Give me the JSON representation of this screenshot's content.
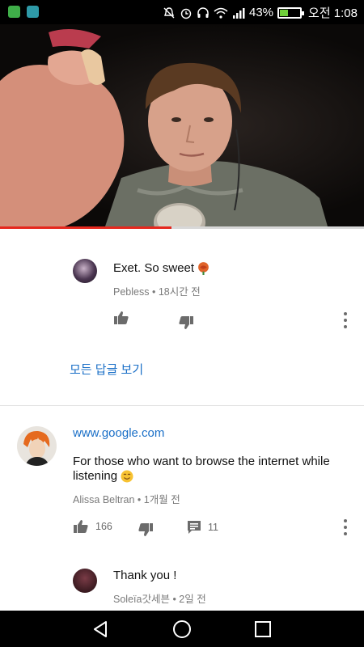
{
  "status_bar": {
    "signal_percent": "43%",
    "time": "오전 1:08",
    "battery_level": 0.43,
    "icons": [
      "app-notification-green-icon",
      "app-notification-teal-icon",
      "mute-icon",
      "alarm-icon",
      "headphones-icon",
      "wifi-icon",
      "signal-icon",
      "battery-icon"
    ]
  },
  "video": {
    "progress": 0.47,
    "accent": "#e5281e"
  },
  "reply_1": {
    "text": "Exet. So sweet",
    "emoji_icon": "rose-emoji-icon",
    "author": "Pebless",
    "time": "18시간 전"
  },
  "view_all_replies": "모든 답글 보기",
  "comment": {
    "link": "www.google.com",
    "text_line1": "For those who want to browse the internet while",
    "text_line2": "listening",
    "emoji_icon": "smiling-face-icon",
    "author": "Alissa Beltran",
    "time": "1개월 전",
    "likes": "166",
    "replies": "11"
  },
  "reply_2": {
    "text": "Thank you !",
    "author": "Soleïa갓세븐",
    "time": "2일 전"
  },
  "colors": {
    "link": "#1a6fc7",
    "meta": "#7a7a7a",
    "icon": "#6b6b6b"
  }
}
